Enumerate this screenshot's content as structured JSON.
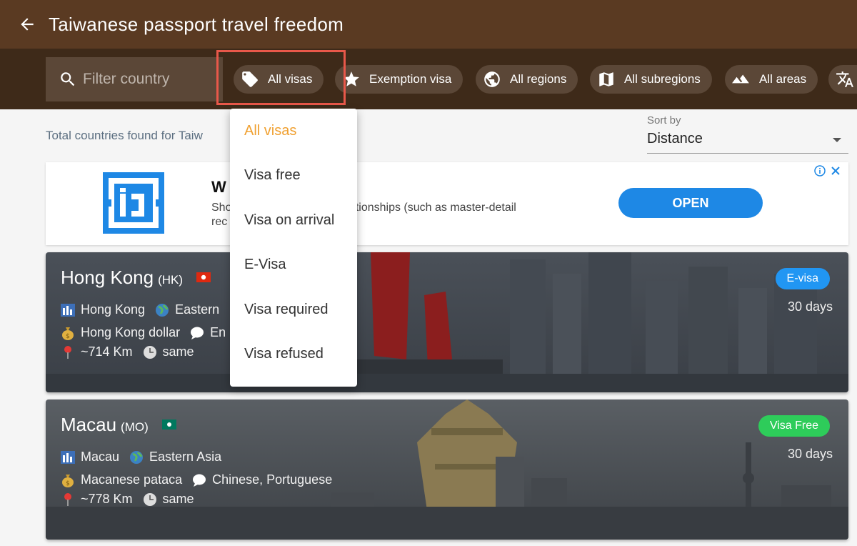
{
  "appbar": {
    "title": "Taiwanese passport travel freedom",
    "back_icon": "arrow-back-icon"
  },
  "search": {
    "placeholder": "Filter country"
  },
  "chips": [
    {
      "label": "All visas",
      "icon": "tag-icon"
    },
    {
      "label": "Exemption visa",
      "icon": "star-icon"
    },
    {
      "label": "All regions",
      "icon": "globe-icon"
    },
    {
      "label": "All subregions",
      "icon": "map-icon"
    },
    {
      "label": "All areas",
      "icon": "terrain-icon"
    },
    {
      "label": "",
      "icon": "translate-icon"
    }
  ],
  "summary": {
    "text": "Total countries found for Taiw"
  },
  "sort": {
    "label": "Sort by",
    "value": "Distance"
  },
  "ad": {
    "title_fragment": "W",
    "desc_line1": "Sho                                       tionships (such as master-detail",
    "desc_line2": "rec",
    "button": "OPEN"
  },
  "dropdown": {
    "options": [
      "All visas",
      "Visa free",
      "Visa on arrival",
      "E-Visa",
      "Visa required",
      "Visa refused"
    ],
    "selected": "All visas"
  },
  "cards": [
    {
      "name": "Hong Kong",
      "code": "(HK)",
      "capital": "Hong Kong",
      "region": "Eastern ",
      "currency": "Hong Kong dollar",
      "language": "En",
      "distance": "~714 Km",
      "timezone": "same",
      "badge": "E-visa",
      "days": "30 days",
      "badge_color": "#2196f3"
    },
    {
      "name": "Macau",
      "code": "(MO)",
      "capital": "Macau",
      "region": "Eastern Asia",
      "currency": "Macanese pataca",
      "language": "Chinese, Portuguese",
      "distance": "~778 Km",
      "timezone": "same",
      "badge": "Visa Free",
      "days": "30 days",
      "badge_color": "#2ecc5a"
    }
  ],
  "colors": {
    "appbar": "#5a3a22",
    "filterbar": "#3e2a19",
    "chip": "#5b4737",
    "accent": "#f0a030",
    "ad_blue": "#1e88e5"
  }
}
